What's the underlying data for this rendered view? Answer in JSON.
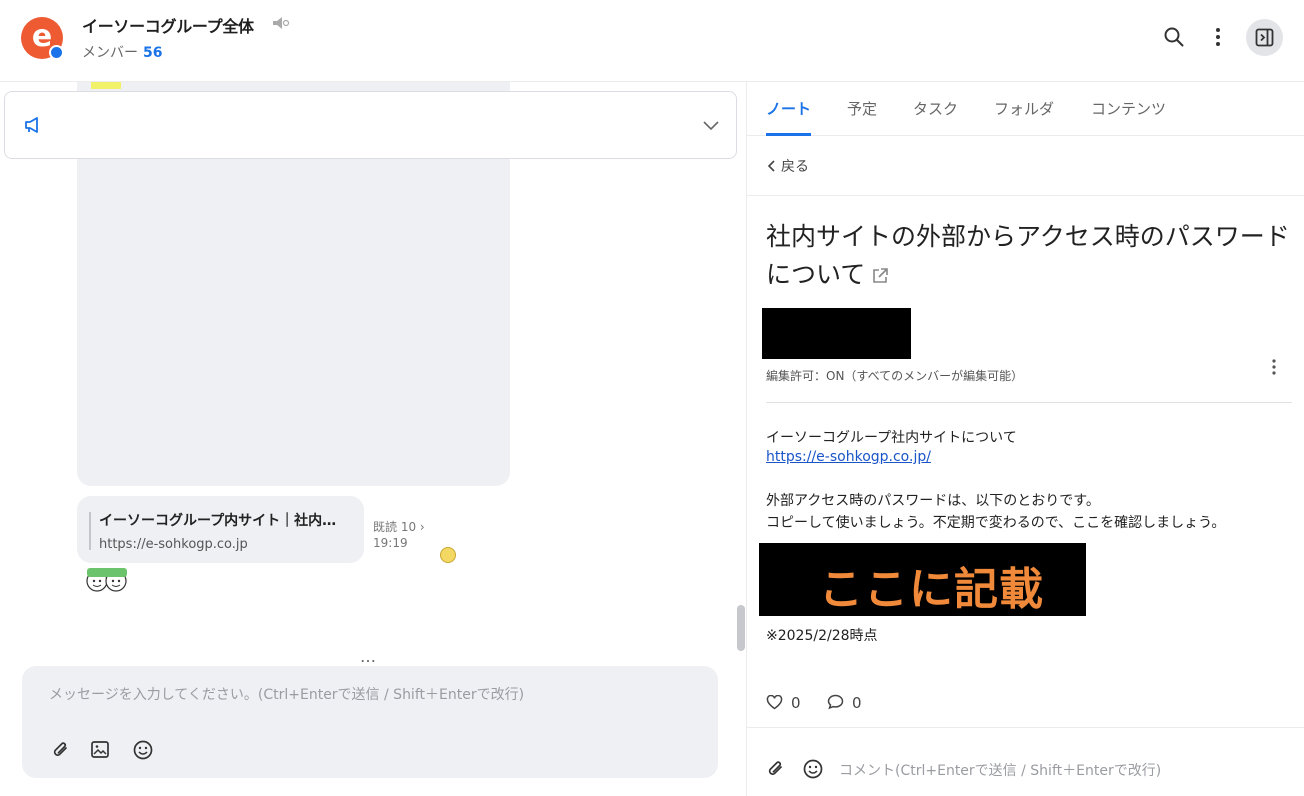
{
  "header": {
    "title": "イーソーコグループ全体",
    "members_label": "メンバー",
    "members_count": "56"
  },
  "chat": {
    "link_title": "イーソーコグループ内サイト｜社内…",
    "link_url": "https://e-sohkogp.co.jp",
    "read_label": "既読 10 ›",
    "time": "19:19",
    "more": "…",
    "composer_placeholder": "メッセージを入力してください。(Ctrl+Enterで送信 / Shift＋Enterで改行)"
  },
  "panel": {
    "tabs": [
      "ノート",
      "予定",
      "タスク",
      "フォルダ",
      "コンテンツ"
    ],
    "back_label": "戻る",
    "note_title": "社内サイトの外部からアクセス時のパスワードについて",
    "edit_permission": "編集許可：ON（すべてのメンバーが編集可能）",
    "body_line1": "イーソーコグループ社内サイトについて",
    "body_link": "https://e-sohkogp.co.jp/",
    "body_line3": "外部アクセス時のパスワードは、以下のとおりです。",
    "body_line4": "コピーして使いましょう。不定期で変わるので、ここを確認しましょう。",
    "image_text": "ここに記載",
    "footnote": "※2025/2/28時点",
    "likes": "0",
    "comments": "0",
    "comment_placeholder": "コメント(Ctrl+Enterで送信 / Shift＋Enterで改行)"
  },
  "colors": {
    "accent": "#1a73e8",
    "brand": "#ee5a32",
    "image_text": "#f08a3a"
  }
}
